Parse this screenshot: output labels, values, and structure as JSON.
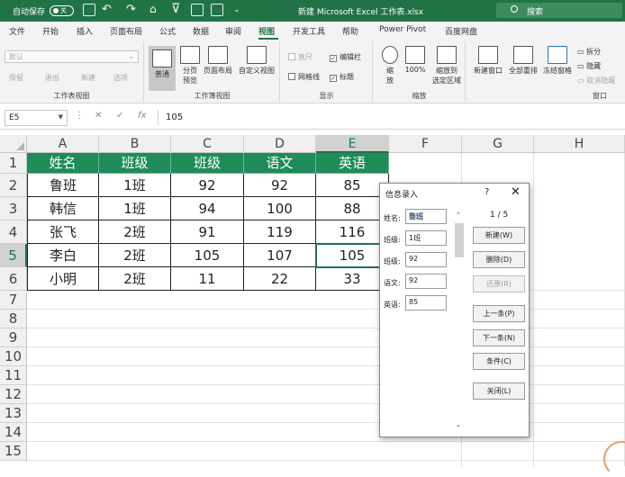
{
  "titlebar": {
    "autosave": "自动保存",
    "toggle": "关",
    "filename": "新建 Microsoft Excel 工作表.xlsx",
    "search": "搜索"
  },
  "tabs": [
    "文件",
    "开始",
    "插入",
    "页面布局",
    "公式",
    "数据",
    "审阅",
    "视图",
    "开发工具",
    "帮助",
    "Power Pivot",
    "百度网盘"
  ],
  "active_tab": "视图",
  "ribbon": {
    "g1": {
      "dropdown": "默认",
      "save": "保留",
      "exit": "退出",
      "new": "新建",
      "options": "选项",
      "label": "工作表视图"
    },
    "g2": {
      "normal": "普通",
      "pagebreak": "分页\n预览",
      "pagelayout": "页面布局",
      "custom": "自定义视图",
      "label": "工作簿视图"
    },
    "g3": {
      "ruler": "直尺",
      "formula_bar": "编辑栏",
      "gridlines": "网格线",
      "headings": "标题",
      "label": "显示"
    },
    "g4": {
      "zoom": "缩\n放",
      "zoom100": "100%",
      "zoomsel": "缩放到\n选定区域",
      "label": "缩放"
    },
    "g5": {
      "newwin": "新建窗口",
      "arrange": "全部重排",
      "freeze": "冻结窗格",
      "split": "拆分",
      "hide": "隐藏",
      "unhide": "取消隐藏",
      "label": "窗口"
    }
  },
  "formula": {
    "namebox": "E5",
    "fx": "fx",
    "content": "105"
  },
  "columns": [
    "A",
    "B",
    "C",
    "D",
    "E",
    "F",
    "G",
    "H"
  ],
  "rows": [
    "1",
    "2",
    "3",
    "4",
    "5",
    "6",
    "7",
    "8",
    "9",
    "10",
    "11",
    "12",
    "13",
    "14",
    "15"
  ],
  "table": {
    "header": [
      "姓名",
      "班级",
      "班级",
      "语文",
      "英语"
    ],
    "rows": [
      [
        "鲁班",
        "1班",
        "92",
        "92",
        "85"
      ],
      [
        "韩信",
        "1班",
        "94",
        "100",
        "88"
      ],
      [
        "张飞",
        "2班",
        "91",
        "119",
        "116"
      ],
      [
        "李白",
        "2班",
        "105",
        "107",
        "105"
      ],
      [
        "小明",
        "2班",
        "11",
        "22",
        "33"
      ]
    ]
  },
  "dialog": {
    "title": "信息录入",
    "help": "?",
    "close": "✕",
    "fields": [
      {
        "label": "姓名:",
        "value": "鲁班"
      },
      {
        "label": "班级:",
        "value": "1班"
      },
      {
        "label": "班级:",
        "value": "92"
      },
      {
        "label": "语文:",
        "value": "92"
      },
      {
        "label": "英语:",
        "value": "85"
      }
    ],
    "counter": "1 / 5",
    "buttons": {
      "new": "新建(W)",
      "delete": "删除(D)",
      "restore": "还原(R)",
      "prev": "上一条(P)",
      "next": "下一条(N)",
      "criteria": "条件(C)",
      "close": "关闭(L)"
    }
  }
}
